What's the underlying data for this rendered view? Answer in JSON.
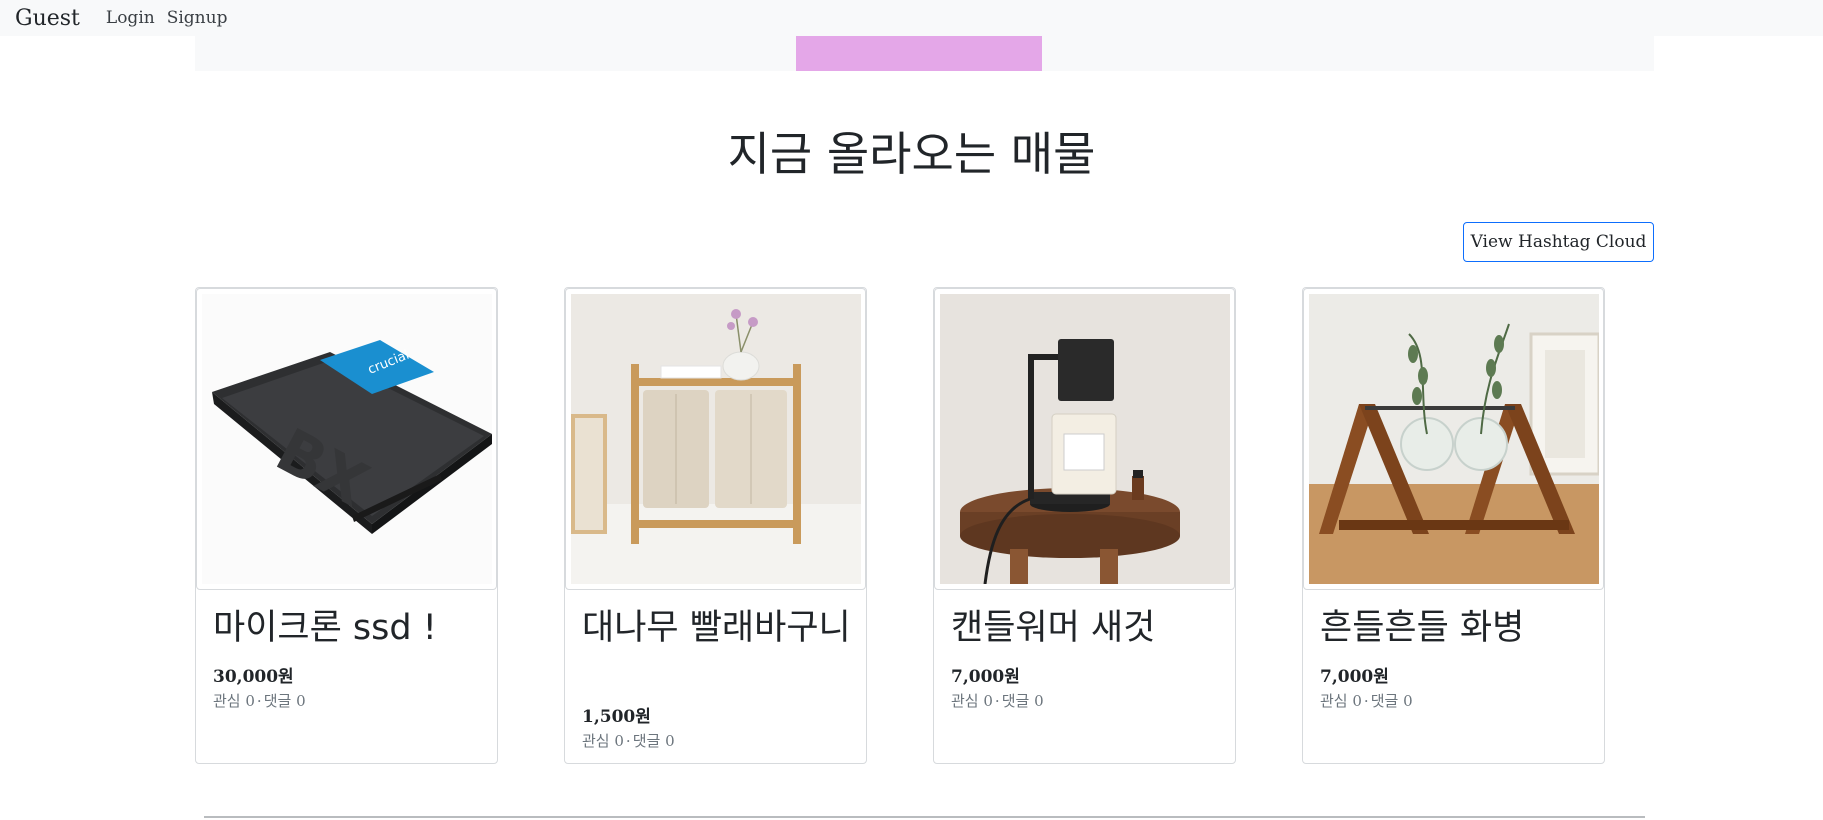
{
  "navbar": {
    "brand": "Guest",
    "login": "Login",
    "signup": "Signup"
  },
  "page": {
    "title": "지금 올라오는 매물"
  },
  "hashtag_button": {
    "label": "View Hashtag Cloud"
  },
  "listings": [
    {
      "title": "마이크론 ssd !",
      "price": "30,000원",
      "interest_label": "관심 0",
      "separator": "·",
      "comments_label": "댓글 0",
      "image": "ssd-image"
    },
    {
      "title": "대나무 빨래바구니",
      "price": "1,500원",
      "interest_label": "관심 0",
      "separator": "·",
      "comments_label": "댓글 0",
      "image": "laundry-basket-image"
    },
    {
      "title": "캔들워머 새것",
      "price": "7,000원",
      "interest_label": "관심 0",
      "separator": "·",
      "comments_label": "댓글 0",
      "image": "candle-warmer-image"
    },
    {
      "title": "흔들흔들 화병",
      "price": "7,000원",
      "interest_label": "관심 0",
      "separator": "·",
      "comments_label": "댓글 0",
      "image": "swing-vase-image"
    }
  ],
  "colors": {
    "navbar_bg": "#f8f9fa",
    "banner_accent": "#e4a7e8",
    "button_border": "#0d6efd",
    "muted_text": "#6c757d"
  }
}
